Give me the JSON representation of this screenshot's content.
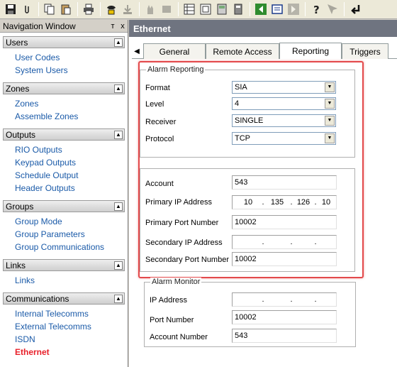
{
  "toolbar": {
    "buttons": [
      "save-icon",
      "attach-icon",
      "copy-icon",
      "paste-icon",
      "print-icon",
      "phone-icon",
      "download-icon",
      "hand-icon",
      "device-icon",
      "grid-icon",
      "screen-icon",
      "keypad-icon",
      "calculator-icon",
      "back-icon",
      "list-icon",
      "forward-icon",
      "help-icon",
      "context-help-icon",
      "enter-icon"
    ]
  },
  "nav": {
    "title": "Navigation Window",
    "pin_glyph": "ᴛ",
    "close_glyph": "x",
    "groups": [
      {
        "label": "Users",
        "items": [
          "User Codes",
          "System Users"
        ]
      },
      {
        "label": "Zones",
        "items": [
          "Zones",
          "Assemble Zones"
        ]
      },
      {
        "label": "Outputs",
        "items": [
          "RIO Outputs",
          "Keypad Outputs",
          "Schedule Output",
          "Header Outputs"
        ]
      },
      {
        "label": "Groups",
        "items": [
          "Group Mode",
          "Group Parameters",
          "Group Communications"
        ]
      },
      {
        "label": "Links",
        "items": [
          "Links"
        ]
      },
      {
        "label": "Communications",
        "items": [
          "Internal Telecomms",
          "External Telecomms",
          "ISDN",
          "Ethernet"
        ]
      }
    ],
    "active_item": "Ethernet"
  },
  "main": {
    "title": "Ethernet",
    "tabs": [
      "General",
      "Remote Access",
      "Reporting",
      "Triggers"
    ],
    "selected_tab": "Reporting",
    "alarm_reporting": {
      "legend": "Alarm Reporting",
      "format_label": "Format",
      "format_value": "SIA",
      "level_label": "Level",
      "level_value": "4",
      "receiver_label": "Receiver",
      "receiver_value": "SINGLE",
      "protocol_label": "Protocol",
      "protocol_value": "TCP",
      "account_label": "Account",
      "account_value": "543",
      "primary_ip_label": "Primary IP Address",
      "primary_ip": [
        "10",
        "135",
        "126",
        "10"
      ],
      "primary_port_label": "Primary Port Number",
      "primary_port_value": "10002",
      "secondary_ip_label": "Secondary IP Address",
      "secondary_ip": [
        "",
        "",
        "",
        ""
      ],
      "secondary_port_label": "Secondary Port Number",
      "secondary_port_value": "10002"
    },
    "alarm_monitor": {
      "legend": "Alarm Monitor",
      "ip_label": "IP Address",
      "port_label": "Port Number",
      "port_value": "10002",
      "account_label": "Account Number",
      "account_value": "543"
    }
  },
  "colors": {
    "highlight": "#e3494b",
    "link": "#1a5aa8",
    "active_link": "#e8202a",
    "title_bar": "#6f7480"
  }
}
